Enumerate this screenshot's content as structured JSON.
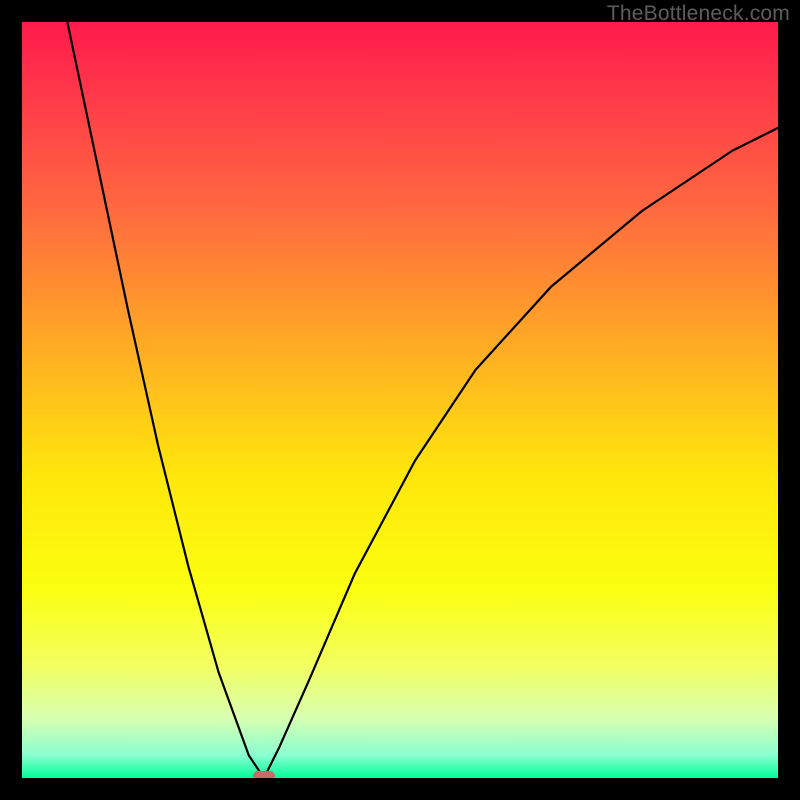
{
  "watermark": {
    "text": "TheBottleneck.com"
  },
  "colors": {
    "black": "#000000",
    "curve": "#000000",
    "marker": "#c76a69",
    "gradient_stops": [
      {
        "offset": 0.0,
        "color": "#ff1a4b"
      },
      {
        "offset": 0.1,
        "color": "#ff3a49"
      },
      {
        "offset": 0.25,
        "color": "#ff6a3f"
      },
      {
        "offset": 0.45,
        "color": "#ffb321"
      },
      {
        "offset": 0.6,
        "color": "#ffe70b"
      },
      {
        "offset": 0.75,
        "color": "#fbff10"
      },
      {
        "offset": 0.85,
        "color": "#f2ff60"
      },
      {
        "offset": 0.92,
        "color": "#d8ffb0"
      },
      {
        "offset": 0.97,
        "color": "#8affd0"
      },
      {
        "offset": 1.0,
        "color": "#00ff99"
      }
    ]
  },
  "chart_data": {
    "type": "line",
    "title": "",
    "xlabel": "",
    "ylabel": "",
    "xlim": [
      0,
      100
    ],
    "ylim": [
      0,
      100
    ],
    "x_min_at": 32,
    "marker": {
      "x": 32,
      "y": 0
    },
    "left_branch": {
      "x": [
        6,
        10,
        14,
        18,
        22,
        26,
        30,
        32
      ],
      "y": [
        100,
        81,
        62,
        44,
        28,
        14,
        3,
        0
      ]
    },
    "right_branch": {
      "x": [
        32,
        34,
        38,
        44,
        52,
        60,
        70,
        82,
        94,
        100
      ],
      "y": [
        0,
        4,
        13,
        27,
        42,
        54,
        65,
        75,
        83,
        86
      ]
    }
  }
}
